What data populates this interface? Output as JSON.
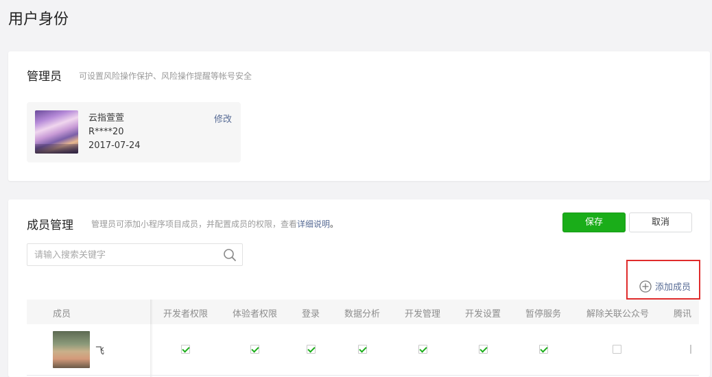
{
  "page": {
    "title": "用户身份"
  },
  "admin": {
    "title": "管理员",
    "description": "可设置风险操作保护、风险操作提醒等帐号安全",
    "name": "云指萱萱",
    "account": "R****20",
    "date": "2017-07-24",
    "edit_label": "修改"
  },
  "members": {
    "title": "成员管理",
    "description_prefix": "管理员可添加小程序项目成员，并配置成员的权限，查看",
    "description_link": "详细说明",
    "description_suffix": "。",
    "save_label": "保存",
    "cancel_label": "取消",
    "search_placeholder": "请输入搜索关键字",
    "add_member_label": "添加成员",
    "columns": [
      "成员",
      "开发者权限",
      "体验者权限",
      "登录",
      "数据分析",
      "开发管理",
      "开发设置",
      "暂停服务",
      "解除关联公众号",
      "腾讯"
    ],
    "rows": [
      {
        "name": "飞",
        "permissions": [
          true,
          true,
          true,
          true,
          true,
          true,
          true,
          false
        ]
      }
    ]
  },
  "colors": {
    "accent": "#1aad19",
    "link": "#576b95",
    "highlight": "#e02b2b"
  }
}
